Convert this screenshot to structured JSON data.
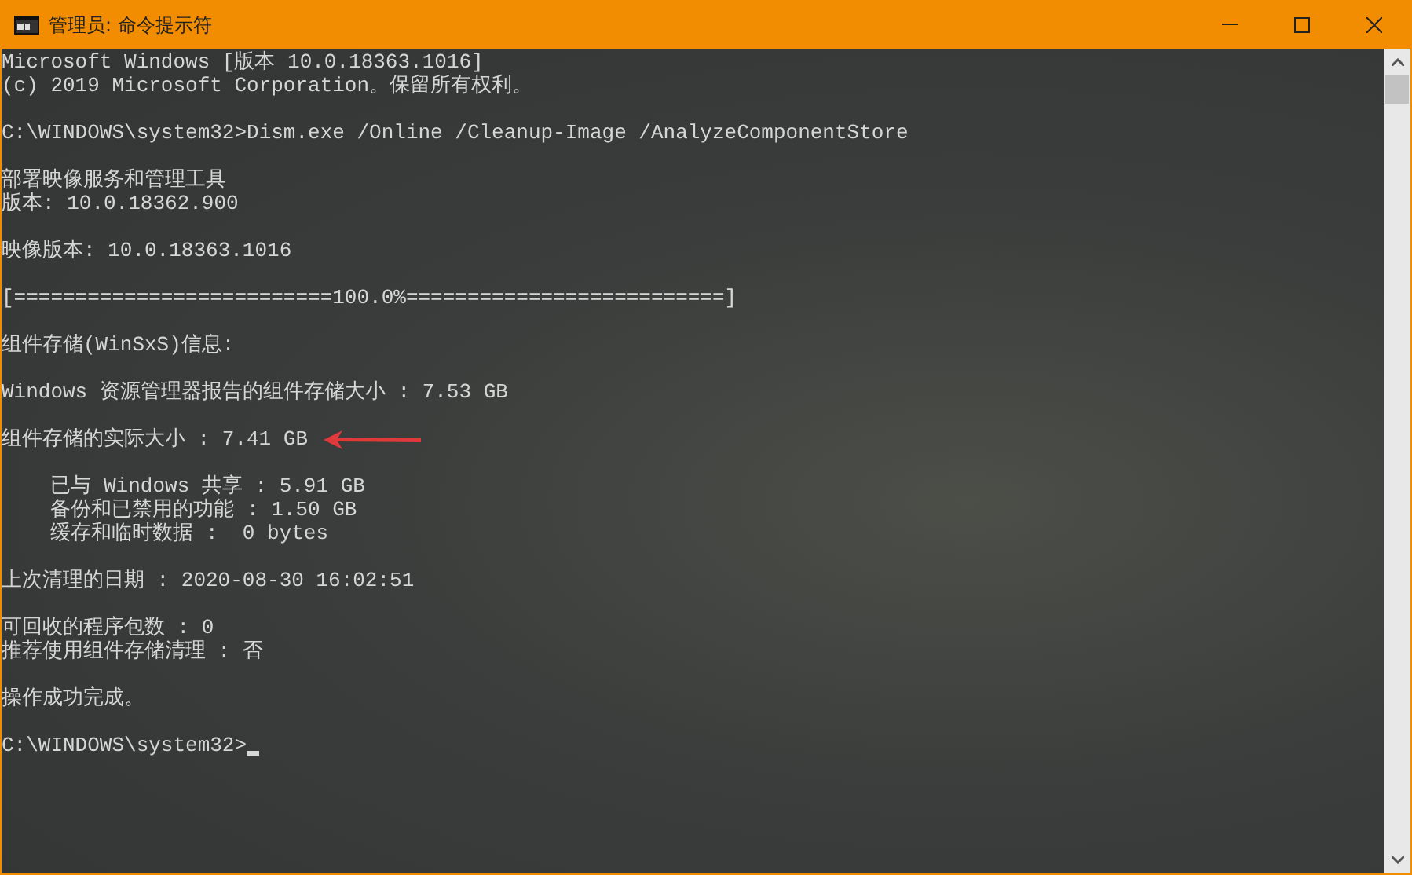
{
  "window": {
    "title": "管理员: 命令提示符"
  },
  "console": {
    "blocks": [
      {
        "lines": [
          {
            "text": "Microsoft Windows [版本 10.0.18363.1016]"
          },
          {
            "text": "(c) 2019 Microsoft Corporation。保留所有权利。"
          }
        ]
      },
      {
        "lines": [
          {
            "text": "C:\\WINDOWS\\system32>Dism.exe /Online /Cleanup-Image /AnalyzeComponentStore"
          }
        ]
      },
      {
        "lines": [
          {
            "text": "部署映像服务和管理工具"
          },
          {
            "text": "版本: 10.0.18362.900"
          }
        ]
      },
      {
        "lines": [
          {
            "text": "映像版本: 10.0.18363.1016"
          }
        ]
      },
      {
        "lines": [
          {
            "text": "[==========================100.0%==========================]"
          }
        ]
      },
      {
        "lines": [
          {
            "text": "组件存储(WinSxS)信息:"
          }
        ]
      },
      {
        "lines": [
          {
            "text": "Windows 资源管理器报告的组件存储大小 : 7.53 GB"
          }
        ]
      },
      {
        "lines": [
          {
            "text": "组件存储的实际大小 : 7.41 GB",
            "arrow": true
          }
        ]
      },
      {
        "lines": [
          {
            "text": "    已与 Windows 共享 : 5.91 GB"
          },
          {
            "text": "    备份和已禁用的功能 : 1.50 GB"
          },
          {
            "text": "    缓存和临时数据 :  0 bytes"
          }
        ]
      },
      {
        "lines": [
          {
            "text": "上次清理的日期 : 2020-08-30 16:02:51"
          }
        ]
      },
      {
        "lines": [
          {
            "text": "可回收的程序包数 : 0"
          },
          {
            "text": "推荐使用组件存储清理 : 否"
          }
        ]
      },
      {
        "lines": [
          {
            "text": "操作成功完成。"
          }
        ]
      },
      {
        "lines": [
          {
            "text": "C:\\WINDOWS\\system32>",
            "cursor": true
          }
        ]
      }
    ]
  }
}
